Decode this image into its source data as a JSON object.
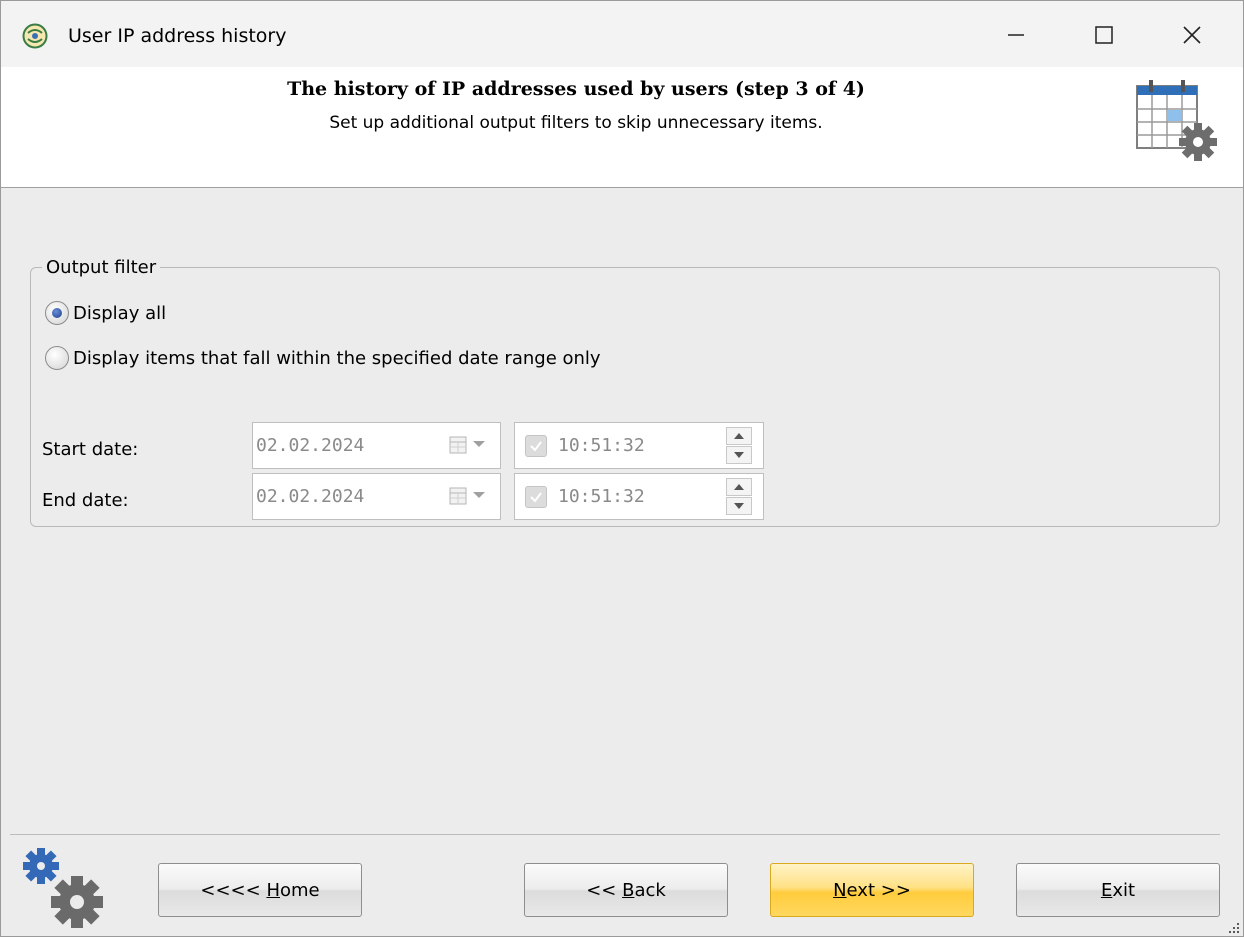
{
  "window": {
    "title": "User IP address history",
    "app_icon": "app-globe-icon",
    "controls": {
      "minimize": "minimize-icon",
      "maximize": "maximize-icon",
      "close": "close-icon"
    }
  },
  "header": {
    "title": "The history of IP addresses used by users (step 3 of 4)",
    "subtitle": "Set up additional output filters to skip unnecessary items.",
    "icon": "calendar-settings-icon"
  },
  "output_filter": {
    "legend": "Output filter",
    "options": [
      {
        "label": "Display all",
        "selected": true
      },
      {
        "label": "Display items that fall within the specified date range only",
        "selected": false
      }
    ],
    "start": {
      "label": "Start date:",
      "date": "02.02.2024",
      "time": "10:51:32"
    },
    "end": {
      "label": "End date:",
      "date": "02.02.2024",
      "time": "10:51:32"
    }
  },
  "footer": {
    "icon": "gears-icon",
    "buttons": {
      "home_pre": "<<<< ",
      "home_key": "H",
      "home_post": "ome",
      "back_pre": "<< ",
      "back_key": "B",
      "back_post": "ack",
      "next_key": "N",
      "next_post": "ext >>",
      "exit_key": "E",
      "exit_post": "xit"
    }
  },
  "colors": {
    "accent_next": "#ffcc3d",
    "background": "#ececec",
    "header_bg": "#ffffff"
  }
}
